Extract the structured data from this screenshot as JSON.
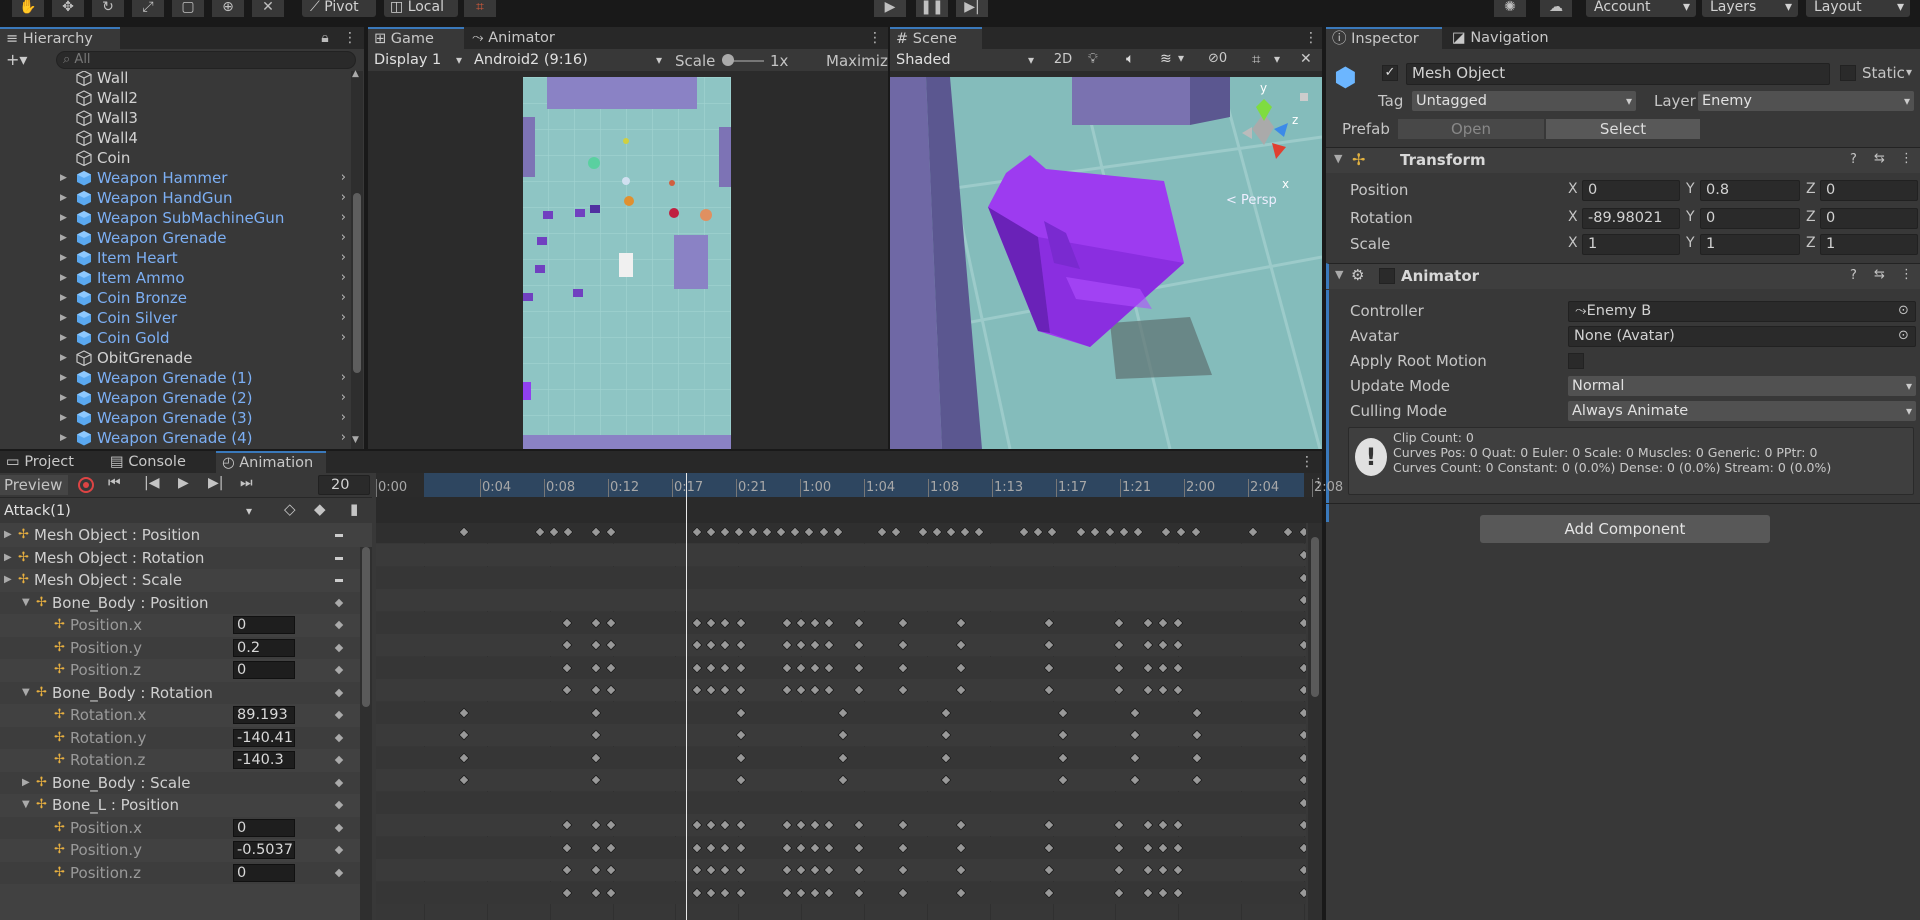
{
  "toolbar": {
    "tools": [
      "hand-tool",
      "move-tool",
      "rotate-tool",
      "scale-tool",
      "rect-tool",
      "transform-tool",
      "custom-tool"
    ],
    "pivot_label": "Pivot",
    "local_label": "Local",
    "account_label": "Account",
    "layers_label": "Layers",
    "layout_label": "Layout"
  },
  "hierarchy": {
    "tab_label": "Hierarchy",
    "search_placeholder": "All",
    "items": [
      {
        "label": "Wall",
        "type": "plain",
        "arrow": false,
        "chevron": false
      },
      {
        "label": "Wall2",
        "type": "plain",
        "arrow": false,
        "chevron": false
      },
      {
        "label": "Wall3",
        "type": "plain",
        "arrow": false,
        "chevron": false
      },
      {
        "label": "Wall4",
        "type": "plain",
        "arrow": false,
        "chevron": false
      },
      {
        "label": "Coin",
        "type": "plain",
        "arrow": false,
        "chevron": false
      },
      {
        "label": "Weapon Hammer",
        "type": "prefab",
        "arrow": true,
        "chevron": true
      },
      {
        "label": "Weapon HandGun",
        "type": "prefab",
        "arrow": true,
        "chevron": true
      },
      {
        "label": "Weapon SubMachineGun",
        "type": "prefab",
        "arrow": true,
        "chevron": true
      },
      {
        "label": "Weapon Grenade",
        "type": "prefab",
        "arrow": true,
        "chevron": true
      },
      {
        "label": "Item Heart",
        "type": "prefab",
        "arrow": true,
        "chevron": true
      },
      {
        "label": "Item Ammo",
        "type": "prefab",
        "arrow": true,
        "chevron": true
      },
      {
        "label": "Coin Bronze",
        "type": "prefab",
        "arrow": true,
        "chevron": true
      },
      {
        "label": "Coin Silver",
        "type": "prefab",
        "arrow": true,
        "chevron": true
      },
      {
        "label": "Coin Gold",
        "type": "prefab",
        "arrow": true,
        "chevron": true
      },
      {
        "label": "ObitGrenade",
        "type": "plain",
        "arrow": true,
        "chevron": false
      },
      {
        "label": "Weapon Grenade (1)",
        "type": "prefab",
        "arrow": true,
        "chevron": true
      },
      {
        "label": "Weapon Grenade (2)",
        "type": "prefab",
        "arrow": true,
        "chevron": true
      },
      {
        "label": "Weapon Grenade (3)",
        "type": "prefab",
        "arrow": true,
        "chevron": true
      },
      {
        "label": "Weapon Grenade (4)",
        "type": "prefab",
        "arrow": true,
        "chevron": true
      }
    ]
  },
  "game": {
    "tab_label": "Game",
    "animator_tab_label": "Animator",
    "display": "Display 1",
    "aspect": "Android2 (9:16)",
    "scale_label": "Scale",
    "scale_value": "1x",
    "maximize_label": "Maximiz"
  },
  "scene": {
    "tab_label": "Scene",
    "shading": "Shaded",
    "mode_2d": "2D",
    "hidden_count": "0",
    "persp_label": "< Persp",
    "axis_y": "y",
    "axis_z": "z",
    "axis_x": "x"
  },
  "inspector": {
    "tab_label": "Inspector",
    "nav_tab_label": "Navigation",
    "object_name": "Mesh Object",
    "static_label": "Static",
    "tag_label": "Tag",
    "tag_value": "Untagged",
    "layer_label": "Layer",
    "layer_value": "Enemy",
    "prefab_label": "Prefab",
    "open_label": "Open",
    "select_label": "Select",
    "transform": {
      "title": "Transform",
      "position_label": "Position",
      "rotation_label": "Rotation",
      "scale_label": "Scale",
      "position": {
        "x": "0",
        "y": "0.8",
        "z": "0"
      },
      "rotation": {
        "x": "-89.98021",
        "y": "0",
        "z": "0"
      },
      "scale": {
        "x": "1",
        "y": "1",
        "z": "1"
      }
    },
    "animator": {
      "title": "Animator",
      "controller_label": "Controller",
      "controller_value": "Enemy B",
      "avatar_label": "Avatar",
      "avatar_value": "None (Avatar)",
      "root_motion_label": "Apply Root Motion",
      "update_mode_label": "Update Mode",
      "update_mode_value": "Normal",
      "culling_mode_label": "Culling Mode",
      "culling_mode_value": "Always Animate",
      "info_line1": "Clip Count: 0",
      "info_line2": "Curves Pos: 0 Quat: 0 Euler: 0 Scale: 0 Muscles: 0 Generic: 0 PPtr: 0",
      "info_line3": "Curves Count: 0 Constant: 0 (0.0%) Dense: 0 (0.0%) Stream: 0 (0.0%)"
    },
    "add_component_label": "Add Component"
  },
  "animation": {
    "project_tab": "Project",
    "console_tab": "Console",
    "animation_tab": "Animation",
    "preview_label": "Preview",
    "frame_value": "20",
    "clip_name": "Attack(1)",
    "ticks": [
      "0:00",
      "0:04",
      "0:08",
      "0:12",
      "0:17",
      "0:21",
      "1:00",
      "1:04",
      "1:08",
      "1:13",
      "1:17",
      "1:21",
      "2:00",
      "2:04",
      "2:08"
    ],
    "properties": [
      {
        "label": "Mesh Object : Position",
        "indent": 0,
        "expand": "closed",
        "value": "",
        "sub": false
      },
      {
        "label": "Mesh Object : Rotation",
        "indent": 0,
        "expand": "closed",
        "value": "",
        "sub": false
      },
      {
        "label": "Mesh Object : Scale",
        "indent": 0,
        "expand": "closed",
        "value": "",
        "sub": false
      },
      {
        "label": "Bone_Body : Position",
        "indent": 1,
        "expand": "open",
        "value": "",
        "sub": false
      },
      {
        "label": "Position.x",
        "indent": 2,
        "expand": "none",
        "value": "0",
        "sub": true
      },
      {
        "label": "Position.y",
        "indent": 2,
        "expand": "none",
        "value": "0.2",
        "sub": true
      },
      {
        "label": "Position.z",
        "indent": 2,
        "expand": "none",
        "value": "0",
        "sub": true
      },
      {
        "label": "Bone_Body : Rotation",
        "indent": 1,
        "expand": "open",
        "value": "",
        "sub": false
      },
      {
        "label": "Rotation.x",
        "indent": 2,
        "expand": "none",
        "value": "89.193",
        "sub": true
      },
      {
        "label": "Rotation.y",
        "indent": 2,
        "expand": "none",
        "value": "-140.41",
        "sub": true
      },
      {
        "label": "Rotation.z",
        "indent": 2,
        "expand": "none",
        "value": "-140.3",
        "sub": true
      },
      {
        "label": "Bone_Body : Scale",
        "indent": 1,
        "expand": "closed",
        "value": "",
        "sub": false
      },
      {
        "label": "Bone_L : Position",
        "indent": 1,
        "expand": "open",
        "value": "",
        "sub": false
      },
      {
        "label": "Position.x",
        "indent": 2,
        "expand": "none",
        "value": "0",
        "sub": true
      },
      {
        "label": "Position.y",
        "indent": 2,
        "expand": "none",
        "value": "-0.5037",
        "sub": true
      },
      {
        "label": "Position.z",
        "indent": 2,
        "expand": "none",
        "value": "0",
        "sub": true
      }
    ],
    "key_patterns": {
      "summary": [
        0.046,
        0.132,
        0.148,
        0.164,
        0.196,
        0.212,
        0.31,
        0.326,
        0.342,
        0.358,
        0.374,
        0.39,
        0.406,
        0.422,
        0.438,
        0.454,
        0.47,
        0.52,
        0.536,
        0.567,
        0.583,
        0.599,
        0.615,
        0.631,
        0.682,
        0.698,
        0.714,
        0.747,
        0.763,
        0.779,
        0.795,
        0.811,
        0.843,
        0.86,
        0.877,
        0.942,
        0.982,
        1.0
      ],
      "pos": [
        0.163,
        0.196,
        0.212,
        0.31,
        0.326,
        0.342,
        0.36,
        0.412,
        0.428,
        0.444,
        0.46,
        0.494,
        0.544,
        0.61,
        0.71,
        0.79,
        0.823,
        0.84,
        0.857,
        1.0
      ],
      "rot": [
        0.046,
        0.196,
        0.36,
        0.476,
        0.593,
        0.726,
        0.808,
        0.878,
        1.0
      ],
      "single": [
        1.0
      ]
    }
  }
}
